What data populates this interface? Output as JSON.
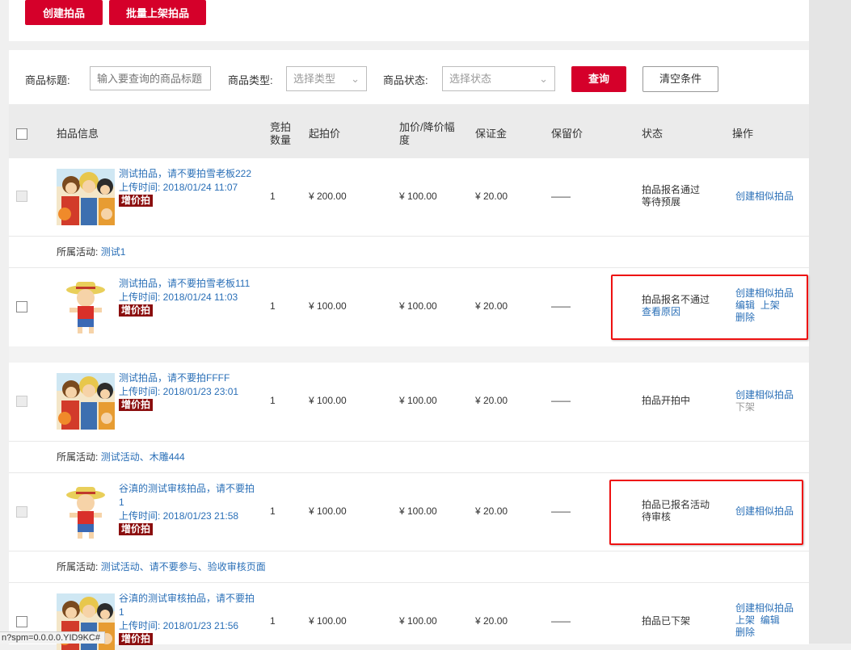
{
  "toolbar": {
    "create_label": "创建拍品",
    "batch_label": "批量上架拍品"
  },
  "filters": {
    "title_label": "商品标题:",
    "title_placeholder": "输入要查询的商品标题",
    "type_label": "商品类型:",
    "type_value": "选择类型",
    "status_label": "商品状态:",
    "status_value": "选择状态",
    "query_label": "查询",
    "clear_label": "清空条件"
  },
  "table": {
    "headers": {
      "info": "拍品信息",
      "qty_line1": "竞拍",
      "qty_line2": "数量",
      "start": "起拍价",
      "step_line1": "加价/降价幅",
      "step_line2": "度",
      "deposit": "保证金",
      "reserve": "保留价",
      "status": "状态",
      "actions": "操作"
    },
    "rows": [
      {
        "title_line1": "测试拍品，请不要拍雪老板222",
        "title_line2": "",
        "upload": "上传时间:  2018/01/24 11:07",
        "badge": "增价拍",
        "qty": "1",
        "start": "¥ 200.00",
        "step": "¥ 100.00",
        "deposit": "¥ 20.00",
        "reserve": "——",
        "status_line1": "拍品报名通过",
        "status_line2": "等待预展",
        "status_link": "",
        "action1": "创建相似拍品",
        "action2": "",
        "action2b": "",
        "action3": "",
        "activity_label": "所属活动:",
        "activity": "测试1"
      },
      {
        "title_line1": "测试拍品，请不要拍雪老板111",
        "title_line2": "",
        "upload": "上传时间:  2018/01/24 11:03",
        "badge": "增价拍",
        "qty": "1",
        "start": "¥ 100.00",
        "step": "¥ 100.00",
        "deposit": "¥ 20.00",
        "reserve": "——",
        "status_line1": "拍品报名不通过",
        "status_line2": "",
        "status_link": "查看原因",
        "action1": "创建相似拍品",
        "action2": "编辑",
        "action2b": "上架",
        "action3": "删除",
        "activity_label": "",
        "activity": ""
      },
      {
        "title_line1": "测试拍品，请不要拍FFFF",
        "title_line2": "",
        "upload": "上传时间:  2018/01/23 23:01",
        "badge": "增价拍",
        "qty": "1",
        "start": "¥ 100.00",
        "step": "¥ 100.00",
        "deposit": "¥ 20.00",
        "reserve": "——",
        "status_line1": "拍品开拍中",
        "status_line2": "",
        "status_link": "",
        "action1": "创建相似拍品",
        "action2": "下架",
        "action2b": "",
        "action3": "",
        "activity_label": "所属活动:",
        "activity": "测试活动、木雕444"
      },
      {
        "title_line1": "谷滇的测试审核拍品，请不要拍",
        "title_line2": "1",
        "upload": "上传时间:  2018/01/23 21:58",
        "badge": "增价拍",
        "qty": "1",
        "start": "¥ 100.00",
        "step": "¥ 100.00",
        "deposit": "¥ 20.00",
        "reserve": "——",
        "status_line1": "拍品已报名活动",
        "status_line2": "待审核",
        "status_link": "",
        "action1": "创建相似拍品",
        "action2": "",
        "action2b": "",
        "action3": "",
        "activity_label": "所属活动:",
        "activity": "测试活动、请不要参与、验收审核页面"
      },
      {
        "title_line1": "谷滇的测试审核拍品，请不要拍",
        "title_line2": "1",
        "upload": "上传时间:  2018/01/23 21:56",
        "badge": "增价拍",
        "qty": "1",
        "start": "¥ 100.00",
        "step": "¥ 100.00",
        "deposit": "¥ 20.00",
        "reserve": "——",
        "status_line1": "拍品已下架",
        "status_line2": "",
        "status_link": "",
        "action1": "创建相似拍品",
        "action2": "上架",
        "action2b": "编辑",
        "action3": "删除",
        "activity_label": "",
        "activity": ""
      }
    ]
  },
  "status_bar": {
    "url": "n?spm=0.0.0.0.YID9KC#"
  }
}
